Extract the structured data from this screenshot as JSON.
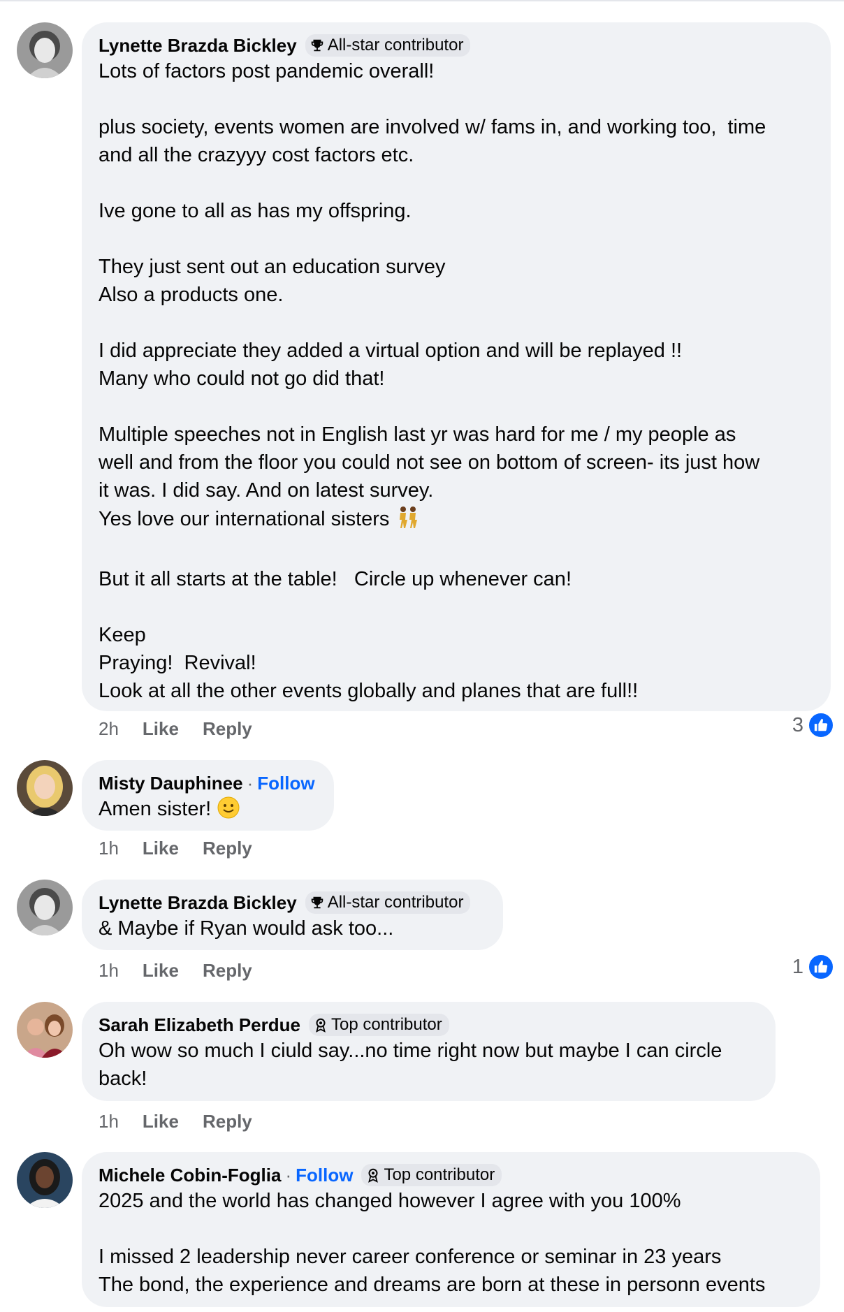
{
  "colors": {
    "bubble": "#f0f2f5",
    "link": "#0866ff",
    "meta": "#65676b",
    "like": "#0866ff"
  },
  "labels": {
    "like": "Like",
    "reply": "Reply",
    "follow": "Follow"
  },
  "comments": [
    {
      "author": "Lynette Brazda Bickley",
      "badge": "All-star contributor",
      "badge_icon": "trophy-icon",
      "text": "Lots of factors post pandemic overall!\n\nplus society, events women are involved w/ fams in, and working too,  time\nand all the crazyyy cost factors etc.\n\nIve gone to all as has my offspring.\n\nThey just sent out an education survey\nAlso a products one.\n\nI did appreciate they added a virtual option and will be replayed !!\nMany who could not go did that!\n\nMultiple speeches not in English last yr was hard for me / my people as\nwell and from the floor you could not see on bottom of screen- its just how\nit was. I did say. And on latest survey.\nYes love our international sisters",
      "emoji": "dancers-emoji",
      "text_after": "\n\nBut it all starts at the table!   Circle up whenever can!\n\nKeep\nPraying!  Revival!\nLook at all the other events globally and planes that are full!!",
      "time": "2h",
      "reactions": "3"
    },
    {
      "author": "Misty Dauphinee",
      "follow": "Follow",
      "text": "Amen sister!",
      "emoji": "smile-emoji",
      "time": "1h"
    },
    {
      "author": "Lynette Brazda Bickley",
      "badge": "All-star contributor",
      "badge_icon": "trophy-icon",
      "text": "& Maybe if Ryan would ask too...",
      "time": "1h",
      "reactions": "1"
    },
    {
      "author": "Sarah Elizabeth Perdue",
      "badge": "Top contributor",
      "badge_icon": "medal-icon",
      "text": "Oh wow so much I ciuld say...no time right now but maybe I can circle\nback!",
      "time": "1h"
    },
    {
      "author": "Michele Cobin-Foglia",
      "follow": "Follow",
      "badge": "Top contributor",
      "badge_icon": "medal-icon",
      "text": "2025 and the world has changed however I agree with you 100%\n\nI missed 2 leadership never career conference or seminar in 23 years\nThe bond, the experience and dreams are born at these in personn events"
    }
  ]
}
